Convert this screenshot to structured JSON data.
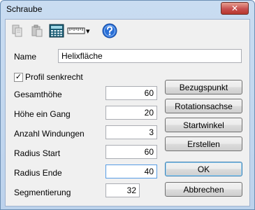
{
  "window": {
    "title": "Schraube",
    "close_label": "✕"
  },
  "toolbar": {
    "icons": [
      "copy-icon",
      "paste-icon",
      "calculator-icon",
      "ruler-dropdown-icon",
      "help-icon"
    ],
    "ruler_dropdown_arrow": "▾"
  },
  "form": {
    "name_label": "Name",
    "name_value": "Helixfläche",
    "profile_vertical_label": "Profil senkrecht",
    "profile_vertical_checked": true,
    "checkmark": "✓",
    "fields": [
      {
        "label": "Gesamthöhe",
        "value": "60"
      },
      {
        "label": "Höhe ein Gang",
        "value": "20"
      },
      {
        "label": "Anzahl Windungen",
        "value": "3"
      },
      {
        "label": "Radius Start",
        "value": "60"
      },
      {
        "label": "Radius Ende",
        "value": "40"
      },
      {
        "label": "Segmentierung",
        "value": "32"
      }
    ]
  },
  "buttons": {
    "reference_point": "Bezugspunkt",
    "rotation_axis": "Rotationsachse",
    "start_angle": "Startwinkel",
    "create": "Erstellen",
    "ok": "OK",
    "cancel": "Abbrechen"
  },
  "colors": {
    "accent": "#1f5fbf",
    "close_red": "#c75050"
  }
}
